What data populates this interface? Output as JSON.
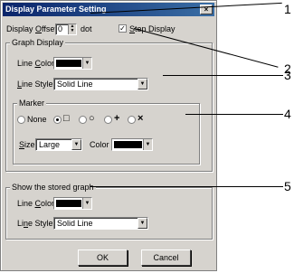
{
  "dialog": {
    "title": "Display Parameter Setting",
    "close": "×"
  },
  "offset": {
    "label_pre": "Display ",
    "label_ul": "O",
    "label_post": "ffset",
    "value": "0",
    "unit": "dot"
  },
  "step_display": {
    "label_ul": "S",
    "label_post": "tep Display",
    "checked": true
  },
  "graph_display": {
    "title": "Graph Display",
    "line_color_pre": "Line ",
    "line_color_ul": "C",
    "line_color_post": "olor",
    "line_style_ul": "L",
    "line_style_post": "ine Style",
    "line_style_value": "Solid Line",
    "marker": {
      "title": "Marker",
      "none_label": "None",
      "options": [
        "□",
        "○",
        "+",
        "×"
      ],
      "size_ul": "S",
      "size_post": "ize",
      "size_value": "Large",
      "color_label": "Color"
    }
  },
  "stored_graph": {
    "title": "Show the stored graph",
    "line_color_pre": "Line ",
    "line_color_ul": "C",
    "line_color_post": "olor",
    "line_style_pre": "Li",
    "line_style_ul": "n",
    "line_style_post": "e Style",
    "line_style_value": "Solid Line"
  },
  "buttons": {
    "ok": "OK",
    "cancel": "Cancel"
  },
  "callouts": [
    "1",
    "2",
    "3",
    "4",
    "5"
  ],
  "colors": {
    "face": "#d6d3ce",
    "swatch": "#000000",
    "title_start": "#0a246a",
    "title_end": "#3a6ea5"
  }
}
